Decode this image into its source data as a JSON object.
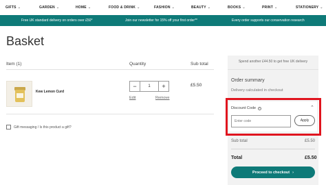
{
  "nav": {
    "items": [
      {
        "label": "GIFTS"
      },
      {
        "label": "GARDEN"
      },
      {
        "label": "HOME"
      },
      {
        "label": "FOOD & DRINK"
      },
      {
        "label": "FASHION"
      },
      {
        "label": "BEAUTY"
      },
      {
        "label": "BOOKS"
      },
      {
        "label": "PRINT"
      },
      {
        "label": "STATIONERY"
      }
    ]
  },
  "promo": {
    "delivery": "Free UK standard delivery on orders over £50*",
    "newsletter": "Join our newsletter for 15% off your first order**",
    "conservation": "Every order supports our conservation research"
  },
  "page": {
    "title": "Basket"
  },
  "basket": {
    "col_item": "Item (1)",
    "col_quantity": "Quantity",
    "col_subtotal": "Sub total",
    "product": {
      "name": "Kew Lemon Curd",
      "quantity": "1",
      "subtotal": "£5.50",
      "edit_label": "Edit",
      "remove_label": "Remove"
    },
    "gift_message_label": "Gift messaging / Is this product a gift?"
  },
  "summary": {
    "free_delivery_note": "Spend another £44.50 to get free UK delivery",
    "title": "Order summary",
    "delivery_note": "Delivery calculated in checkout",
    "discount": {
      "label": "Discount Code",
      "placeholder": "Enter code",
      "apply_label": "Apply"
    },
    "subtotal_label": "Sub total",
    "subtotal_value": "£5.50",
    "total_label": "Total",
    "total_value": "£5.50",
    "checkout_label": "Proceed to checkout"
  },
  "colors": {
    "brand_teal": "#0e7a78",
    "highlight_red": "#e0141e"
  }
}
